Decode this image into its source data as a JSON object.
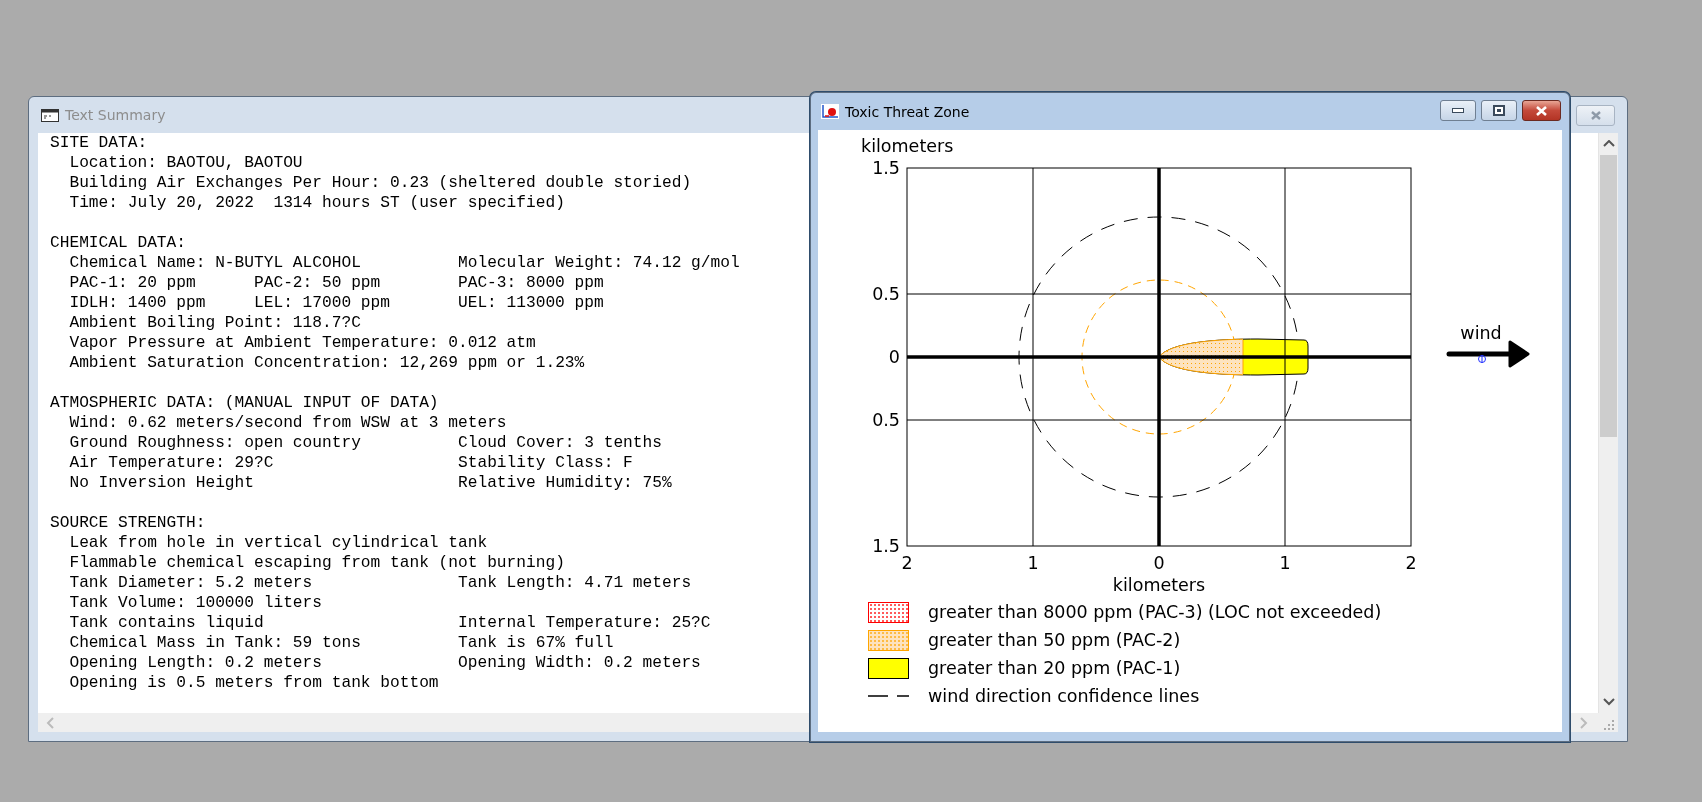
{
  "text_summary": {
    "title": "Text Summary",
    "active": false,
    "sections": [
      {
        "heading": "SITE DATA:",
        "lines": [
          [
            "Location: BAOTOU, BAOTOU"
          ],
          [
            "Building Air Exchanges Per Hour: 0.23 (sheltered double storied)"
          ],
          [
            "Time: July 20, 2022  1314 hours ST (user specified)"
          ]
        ]
      },
      {
        "heading": "CHEMICAL DATA:",
        "lines": [
          [
            "Chemical Name: N-BUTYL ALCOHOL",
            "Molecular Weight: 74.12 g/mol"
          ],
          [
            "PAC-1: 20 ppm",
            "PAC-2: 50 ppm",
            "PAC-3: 8000 ppm"
          ],
          [
            "IDLH: 1400 ppm",
            "LEL: 17000 ppm",
            "UEL: 113000 ppm"
          ],
          [
            "Ambient Boiling Point: 118.7?C"
          ],
          [
            "Vapor Pressure at Ambient Temperature: 0.012 atm"
          ],
          [
            "Ambient Saturation Concentration: 12,269 ppm or 1.23%"
          ]
        ]
      },
      {
        "heading": "ATMOSPHERIC DATA: (MANUAL INPUT OF DATA)",
        "lines": [
          [
            "Wind: 0.62 meters/second from WSW at 3 meters"
          ],
          [
            "Ground Roughness: open country",
            "Cloud Cover: 3 tenths"
          ],
          [
            "Air Temperature: 29?C",
            "Stability Class: F"
          ],
          [
            "No Inversion Height",
            "Relative Humidity: 75%"
          ]
        ]
      },
      {
        "heading": "SOURCE STRENGTH:",
        "lines": [
          [
            "Leak from hole in vertical cylindrical tank"
          ],
          [
            "Flammable chemical escaping from tank (not burning)"
          ],
          [
            "Tank Diameter: 5.2 meters",
            "Tank Length: 4.71 meters"
          ],
          [
            "Tank Volume: 100000 liters"
          ],
          [
            "Tank contains liquid",
            "Internal Temperature: 25?C"
          ],
          [
            "Chemical Mass in Tank: 59 tons",
            "Tank is 67% full"
          ],
          [
            "Opening Length: 0.2 meters",
            "Opening Width: 0.2 meters"
          ],
          [
            "Opening is 0.5 meters from tank bottom"
          ]
        ]
      }
    ]
  },
  "threat_zone": {
    "title": "Toxic Threat Zone",
    "active": true,
    "plot": {
      "y_axis_label": "kilometers",
      "y_ticks": [
        "1.5",
        "0.5",
        "0",
        "0.5",
        "1.5"
      ],
      "x_ticks": [
        "2",
        "1",
        "0",
        "1",
        "2"
      ],
      "x_axis_label": "kilometers"
    },
    "wind": {
      "label": "wind"
    },
    "legend": [
      {
        "kind": "dotted",
        "color": "#ff0000",
        "label": "greater than 8000 ppm (PAC-3) (LOC not exceeded)"
      },
      {
        "kind": "dotted",
        "color": "#ffa500",
        "label": "greater than 50 ppm (PAC-2)"
      },
      {
        "kind": "solid",
        "color": "#ffff00",
        "label": "greater than 20 ppm (PAC-1)"
      },
      {
        "kind": "dashed",
        "label": "wind direction confidence lines"
      }
    ]
  }
}
